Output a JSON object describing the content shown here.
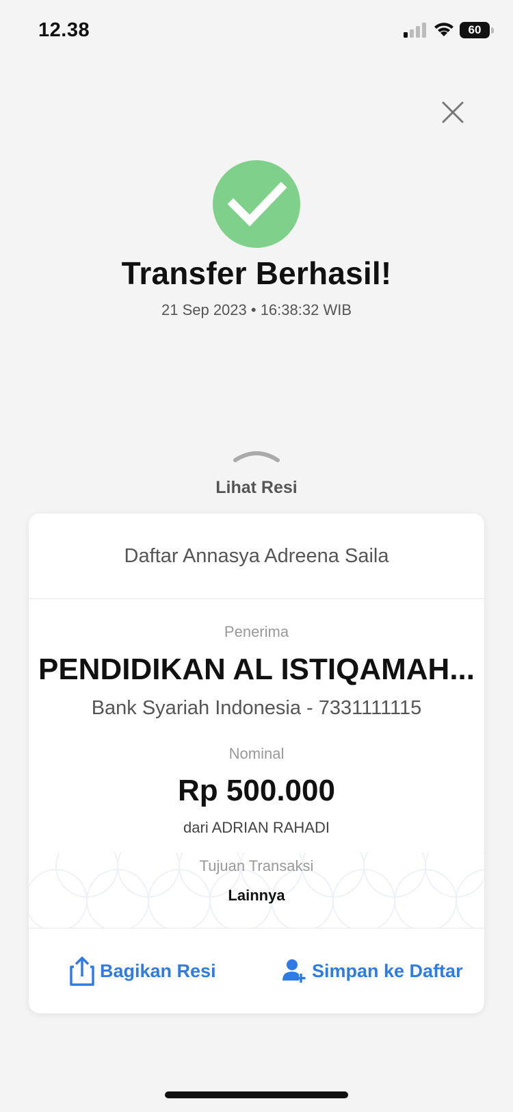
{
  "status_bar": {
    "time": "12.38",
    "battery": "60"
  },
  "success": {
    "title": "Transfer Berhasil!",
    "datetime": "21 Sep 2023 • 16:38:32 WIB",
    "icon_color": "#7fd08a"
  },
  "receipt_toggle": {
    "label": "Lihat Resi"
  },
  "card": {
    "header": "Daftar Annasya Adreena Saila",
    "recipient_label": "Penerima",
    "recipient_name": "PENDIDIKAN AL ISTIQAMAH...",
    "recipient_bank": "Bank Syariah Indonesia - 7331111115",
    "amount_label": "Nominal",
    "amount": "Rp 500.000",
    "from": "dari ADRIAN RAHADI",
    "purpose_label": "Tujuan Transaksi",
    "purpose_value": "Lainnya"
  },
  "actions": {
    "share_label": "Bagikan Resi",
    "save_label": "Simpan ke Daftar",
    "accent_color": "#2f7be5"
  }
}
